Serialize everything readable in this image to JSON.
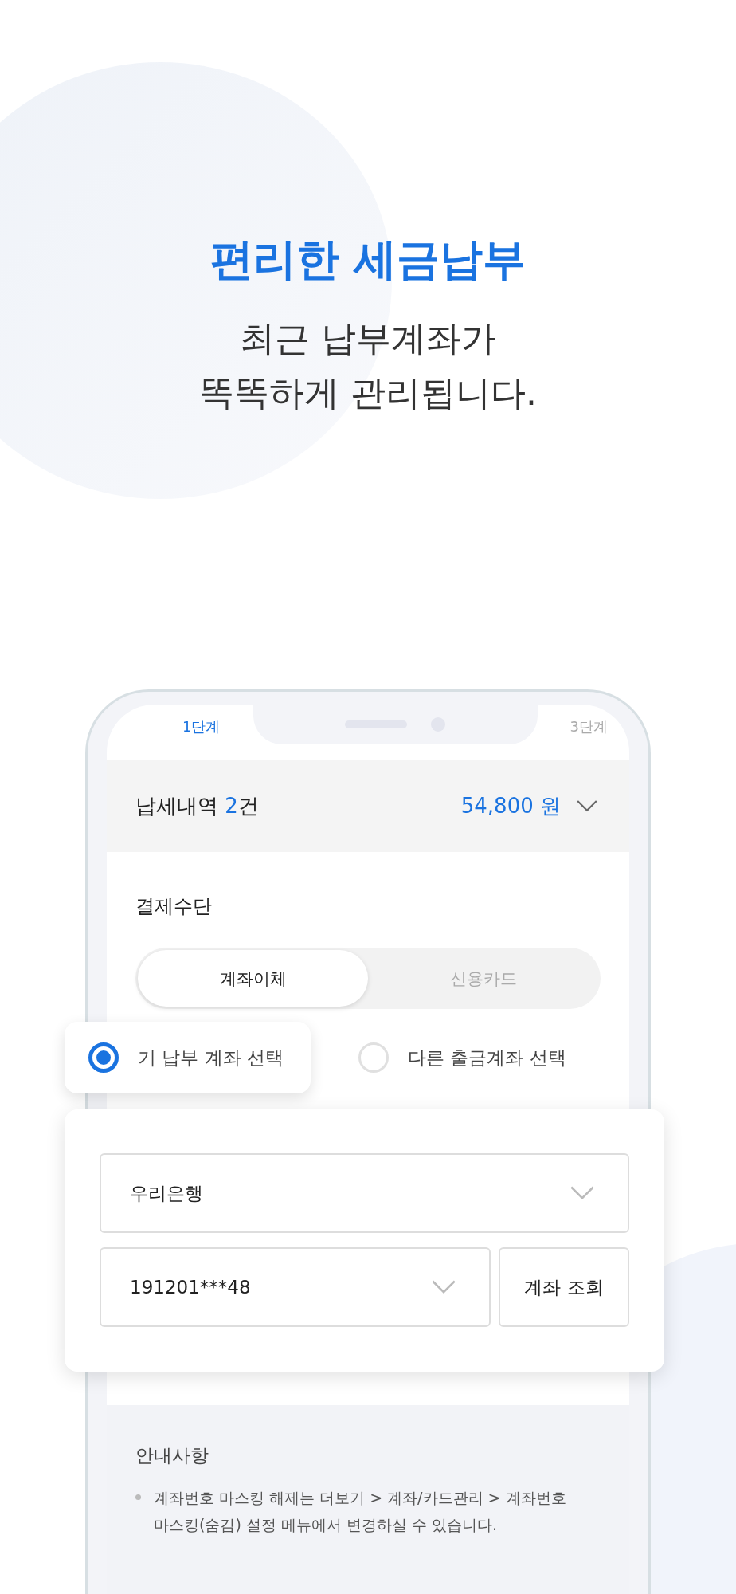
{
  "hero": {
    "title": "편리한 세금납부",
    "subtitle_lines": [
      "최근 납부계좌가",
      "똑똑하게 관리됩니다."
    ]
  },
  "steps": [
    {
      "label": "1단계",
      "selected": true
    },
    {
      "label": "3단계",
      "selected": false
    }
  ],
  "summary": {
    "label": "납세내역",
    "count": "2",
    "count_suffix": "건",
    "amount": "54,800 원"
  },
  "payment": {
    "title": "결제수단",
    "tabs": [
      {
        "label": "계좌이체",
        "selected": true
      },
      {
        "label": "신용카드",
        "selected": false
      }
    ],
    "options": [
      {
        "label": "기 납부 계좌 선택",
        "selected": true
      },
      {
        "label": "다른 출금계좌 선택",
        "selected": false
      }
    ],
    "bank_select": {
      "value": "우리은행"
    },
    "account_select": {
      "value": "191201***48"
    },
    "lookup_button": "계좌 조회"
  },
  "notice": {
    "title": "안내사항",
    "items": [
      "계좌번호 마스킹 해제는 더보기 > 계좌/카드관리 > 계좌번호 마스킹(숨김) 설정 메뉴에서 변경하실 수 있습니다."
    ]
  }
}
